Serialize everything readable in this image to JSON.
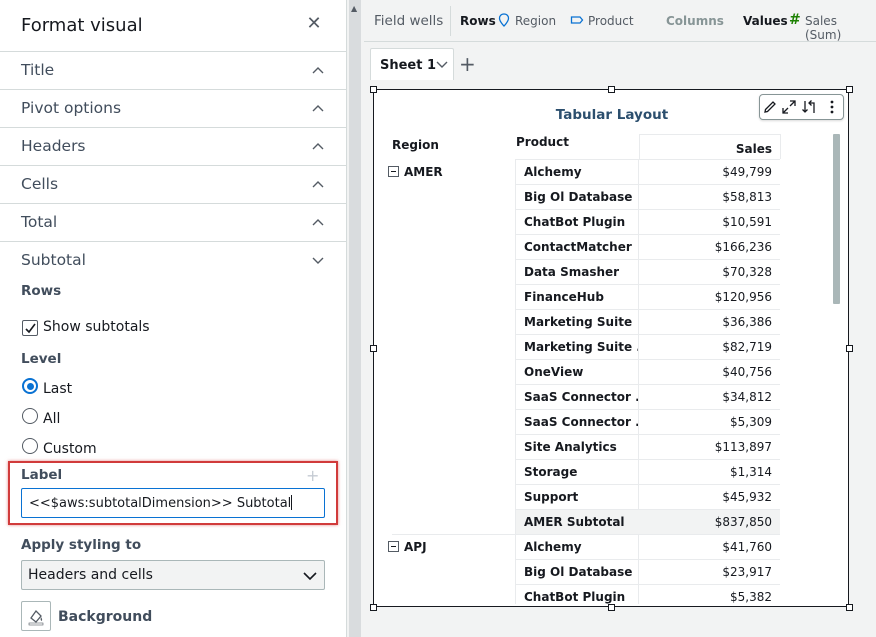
{
  "format_panel": {
    "title": "Format visual",
    "close_icon": "close-icon",
    "sections": [
      {
        "label": "Title",
        "state": "collapsed"
      },
      {
        "label": "Pivot options",
        "state": "collapsed"
      },
      {
        "label": "Headers",
        "state": "collapsed"
      },
      {
        "label": "Cells",
        "state": "collapsed"
      },
      {
        "label": "Total",
        "state": "collapsed"
      },
      {
        "label": "Subtotal",
        "state": "expanded"
      }
    ],
    "subtotal": {
      "rows_label": "Rows",
      "show_subtotals_label": "Show subtotals",
      "show_subtotals_checked": true,
      "level_label": "Level",
      "level_options": [
        "Last",
        "All",
        "Custom"
      ],
      "level_selected": "Last",
      "label_label": "Label",
      "label_value": "<<$aws:subtotalDimension>> Subtotal",
      "apply_styling_label": "Apply styling to",
      "apply_styling_value": "Headers and cells",
      "background_label": "Background"
    }
  },
  "field_wells": {
    "title": "Field wells",
    "rows_label": "Rows",
    "rows_items": [
      "Region",
      "Product"
    ],
    "columns_label": "Columns",
    "values_label": "Values",
    "values_items": [
      "Sales (Sum)"
    ]
  },
  "sheet": {
    "tab_label": "Sheet 1"
  },
  "visual": {
    "title": "Tabular Layout",
    "toolbar_icons": [
      "edit-icon",
      "expand-icon",
      "swap-icon",
      "more-icon"
    ],
    "headers": {
      "region": "Region",
      "product": "Product",
      "sales": "Sales"
    },
    "groups": [
      {
        "region": "AMER",
        "rows": [
          {
            "product": "Alchemy",
            "sales": "$49,799"
          },
          {
            "product": "Big Ol Database",
            "sales": "$58,813"
          },
          {
            "product": "ChatBot Plugin",
            "sales": "$10,591"
          },
          {
            "product": "ContactMatcher",
            "sales": "$166,236"
          },
          {
            "product": "Data Smasher",
            "sales": "$70,328"
          },
          {
            "product": "FinanceHub",
            "sales": "$120,956"
          },
          {
            "product": "Marketing Suite",
            "sales": "$36,386"
          },
          {
            "product": "Marketing Suite ...",
            "sales": "$82,719"
          },
          {
            "product": "OneView",
            "sales": "$40,756"
          },
          {
            "product": "SaaS Connector ...",
            "sales": "$34,812"
          },
          {
            "product": "SaaS Connector ...",
            "sales": "$5,309"
          },
          {
            "product": "Site Analytics",
            "sales": "$113,897"
          },
          {
            "product": "Storage",
            "sales": "$1,314"
          },
          {
            "product": "Support",
            "sales": "$45,932"
          }
        ],
        "subtotal": {
          "product": "AMER Subtotal",
          "sales": "$837,850"
        }
      },
      {
        "region": "APJ",
        "rows": [
          {
            "product": "Alchemy",
            "sales": "$41,760"
          },
          {
            "product": "Big Ol Database",
            "sales": "$23,917"
          },
          {
            "product": "ChatBot Plugin",
            "sales": "$5,382"
          }
        ]
      }
    ]
  },
  "colors": {
    "accent": "#0972d3",
    "highlight": "#d13b3b",
    "title": "#2c4f6e"
  }
}
